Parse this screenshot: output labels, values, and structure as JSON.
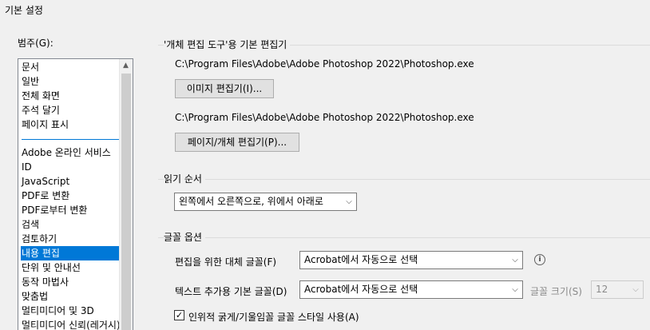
{
  "window": {
    "title": "기본 설정"
  },
  "categories": {
    "label": "범주(G):",
    "group1": [
      "문서",
      "일반",
      "전체 화면",
      "주석 달기",
      "페이지 표시"
    ],
    "group2": [
      "Adobe 온라인 서비스",
      "ID",
      "JavaScript",
      "PDF로 변환",
      "PDF로부터 변환",
      "검색",
      "검토하기",
      "내용 편집",
      "단위 및 안내선",
      "동작 마법사",
      "맞춤법",
      "멀티미디어 및 3D",
      "멀티미디어 신뢰(레거시)"
    ],
    "selected": "내용 편집"
  },
  "editors": {
    "title": "'개체 편집 도구'용 기본 편집기",
    "image_path": "C:\\Program Files\\Adobe\\Adobe Photoshop 2022\\Photoshop.exe",
    "image_button": "이미지 편집기(I)...",
    "page_path": "C:\\Program Files\\Adobe\\Adobe Photoshop 2022\\Photoshop.exe",
    "page_button": "페이지/개체 편집기(P)..."
  },
  "reading": {
    "title": "읽기 순서",
    "value": "왼쪽에서 오른쪽으로, 위에서 아래로"
  },
  "fonts": {
    "title": "글꼴 옵션",
    "fallback_label": "편집을 위한 대체 글꼴(F)",
    "fallback_value": "Acrobat에서 자동으로 선택",
    "default_label": "텍스트 추가용 기본 글꼴(D)",
    "default_value": "Acrobat에서 자동으로 선택",
    "size_label": "글꼴 크기(S)",
    "size_value": "12",
    "faux_style_label": "인위적 굵게/기울임꼴 글꼴 스타일 사용(A)",
    "faux_style_checked": true
  }
}
